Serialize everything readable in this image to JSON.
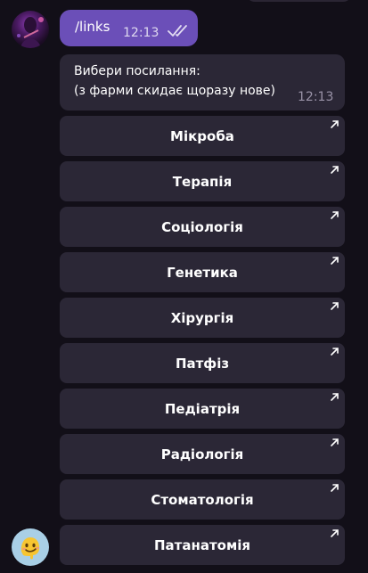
{
  "chat": {
    "outgoing": {
      "text": "/links",
      "time": "12:13",
      "read_status_icon": "double-check-icon"
    },
    "incoming": {
      "line1": "Вибери посилання:",
      "line2": "(з фарми скидає щоразу нове)",
      "time": "12:13"
    },
    "keyboard_buttons": [
      "Мікроба",
      "Терапія",
      "Соціологія",
      "Генетика",
      "Хірургія",
      "Патфіз",
      "Педіатрія",
      "Радіологія",
      "Стоматологія",
      "Патанатомія"
    ],
    "button_icon": "external-link-arrow-icon"
  },
  "colors": {
    "background": "#120f18",
    "outgoing_bubble": "#6b4fb8",
    "incoming_bubble": "#2b2736",
    "button": "#2b2736",
    "text": "#ffffff",
    "time_muted": "#9a93a8"
  }
}
